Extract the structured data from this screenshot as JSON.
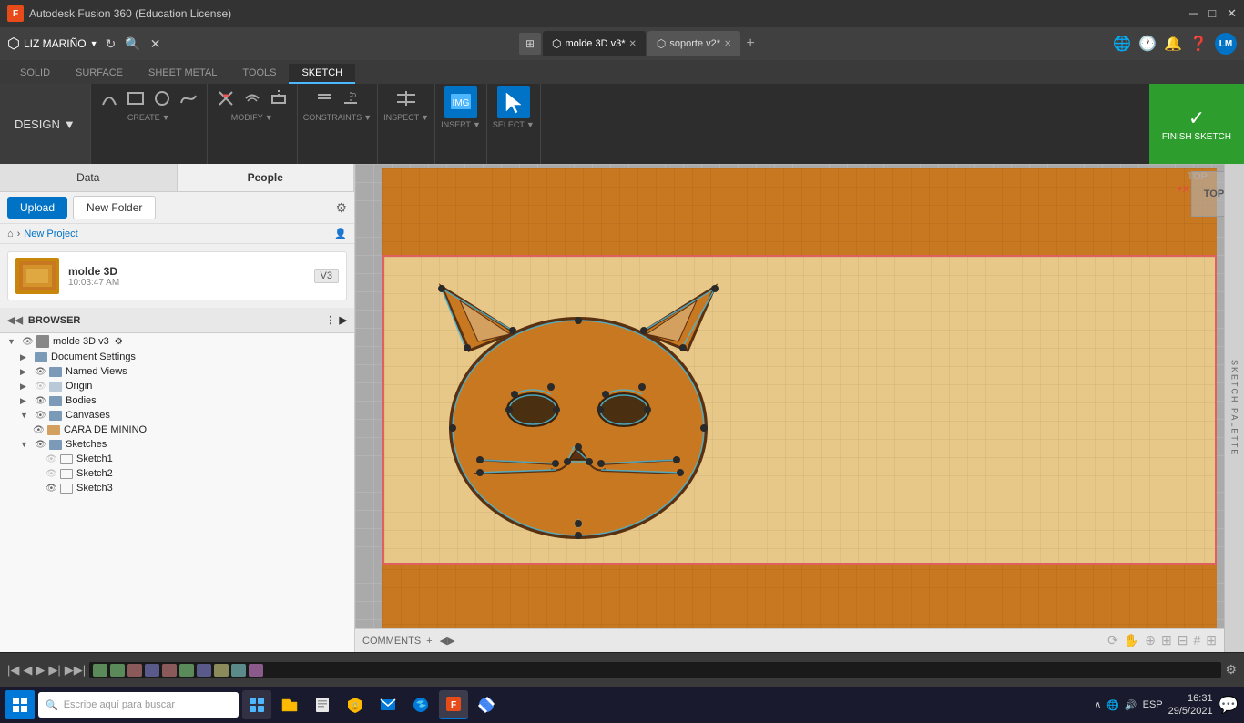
{
  "app": {
    "title": "Autodesk Fusion 360 (Education License)",
    "icon": "F"
  },
  "titlebar": {
    "title": "Autodesk Fusion 360 (Education License)",
    "minimize": "─",
    "maximize": "□",
    "close": "✕"
  },
  "topbar": {
    "user": "LIZ MARIÑO",
    "tab1_label": "molde 3D v3*",
    "tab2_label": "soporte v2*",
    "undo": "↩",
    "redo": "↪"
  },
  "ribbon": {
    "design_label": "DESIGN",
    "tabs": [
      "SOLID",
      "SURFACE",
      "SHEET METAL",
      "TOOLS",
      "SKETCH"
    ],
    "active_tab": "SKETCH",
    "create_label": "CREATE",
    "modify_label": "MODIFY",
    "constraints_label": "CONSTRAINTS",
    "inspect_label": "INSPECT",
    "insert_label": "INSERT",
    "select_label": "SELECT",
    "finish_sketch_label": "FINISH SKETCH"
  },
  "left_panel": {
    "tab_data": "Data",
    "tab_people": "People",
    "upload_label": "Upload",
    "new_folder_label": "New Folder",
    "home_icon": "⌂",
    "project_name": "New Project",
    "file": {
      "name": "molde 3D",
      "time": "10:03:47 AM",
      "version": "V3"
    }
  },
  "browser": {
    "title": "BROWSER",
    "root": "molde 3D v3",
    "items": [
      {
        "label": "Document Settings",
        "level": 1,
        "has_arrow": true
      },
      {
        "label": "Named Views",
        "level": 1,
        "has_arrow": true
      },
      {
        "label": "Origin",
        "level": 1,
        "has_arrow": true
      },
      {
        "label": "Bodies",
        "level": 1,
        "has_arrow": true
      },
      {
        "label": "Canvases",
        "level": 1,
        "has_arrow": true,
        "expanded": true
      },
      {
        "label": "CARA DE MININO",
        "level": 2
      },
      {
        "label": "Sketches",
        "level": 1,
        "has_arrow": true,
        "expanded": true
      },
      {
        "label": "Sketch1",
        "level": 2
      },
      {
        "label": "Sketch2",
        "level": 2
      },
      {
        "label": "Sketch3",
        "level": 2
      }
    ]
  },
  "canvas": {
    "view_label": "TOP"
  },
  "sketch_palette": "SKETCH PALETTE",
  "bottom_toolbar": {
    "orbit": "⟳",
    "pan": "✋",
    "zoom_in": "🔍",
    "zoom_out": "🔍"
  },
  "comments": "COMMENTS",
  "timeline": {
    "settings_icon": "⚙"
  },
  "taskbar": {
    "search_placeholder": "Escribe aquí para buscar",
    "language": "ESP",
    "time": "16:31",
    "date": "29/5/2021"
  }
}
